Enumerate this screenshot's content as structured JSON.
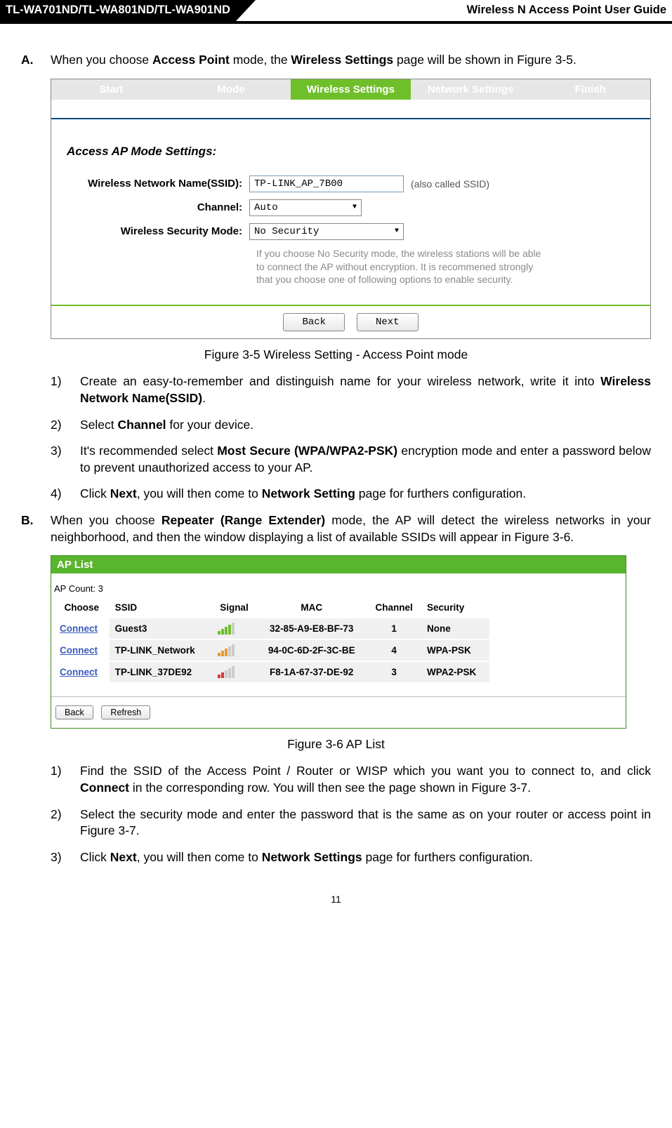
{
  "header": {
    "models": "TL-WA701ND/TL-WA801ND/TL-WA901ND",
    "title": "Wireless N Access Point User Guide"
  },
  "sectionA": {
    "marker": "A.",
    "text_pre": "When you choose ",
    "bold1": "Access Point",
    "text_mid": " mode, the ",
    "bold2": "Wireless Settings",
    "text_post": " page will be shown in Figure 3-5."
  },
  "fig1": {
    "steps": {
      "start": "Start",
      "mode": "Mode",
      "wireless": "Wireless Settings",
      "network": "Network Settings",
      "finish": "Finish"
    },
    "section_title": "Access AP Mode Settings:",
    "ssid_label": "Wireless Network Name(SSID):",
    "ssid_value": "TP-LINK_AP_7B00",
    "also_called": "(also called SSID)",
    "channel_label": "Channel:",
    "channel_value": "Auto",
    "security_label": "Wireless Security Mode:",
    "security_value": "No Security",
    "note": "If you choose No Security mode, the wireless stations will be able to connect the AP without encryption. It is recommened strongly that you choose one of following options to enable security.",
    "back": "Back",
    "next": "Next",
    "caption": "Figure 3-5 Wireless Setting - Access Point mode"
  },
  "listA": {
    "i1": {
      "m": "1)",
      "pre": "Create an easy-to-remember and distinguish name for your wireless network, write it into ",
      "b": "Wireless Network Name(SSID)",
      "post": "."
    },
    "i2": {
      "m": "2)",
      "pre": "Select ",
      "b": "Channel",
      "post": " for your device."
    },
    "i3": {
      "m": "3)",
      "pre": "It's recommended select ",
      "b": "Most Secure (WPA/WPA2-PSK)",
      "post": " encryption mode and enter a password below to prevent unauthorized access to your AP."
    },
    "i4": {
      "m": "4)",
      "pre": "Click ",
      "b1": "Next",
      "mid": ", you will then come to ",
      "b2": "Network Setting",
      "post": " page for furthers configuration."
    }
  },
  "sectionB": {
    "marker": "B.",
    "pre": "When you choose ",
    "b": "Repeater (Range Extender)",
    "post": " mode, the AP will detect the wireless networks in your neighborhood, and then the window displaying a list of available SSIDs will appear in Figure 3-6."
  },
  "fig2": {
    "title": "AP List",
    "count": "AP Count: 3",
    "headers": {
      "choose": "Choose",
      "ssid": "SSID",
      "signal": "Signal",
      "mac": "MAC",
      "channel": "Channel",
      "security": "Security"
    },
    "rows": [
      {
        "connect": "Connect",
        "ssid": "Guest3",
        "mac": "32-85-A9-E8-BF-73",
        "channel": "1",
        "security": "None"
      },
      {
        "connect": "Connect",
        "ssid": "TP-LINK_Network",
        "mac": "94-0C-6D-2F-3C-BE",
        "channel": "4",
        "security": "WPA-PSK"
      },
      {
        "connect": "Connect",
        "ssid": "TP-LINK_37DE92",
        "mac": "F8-1A-67-37-DE-92",
        "channel": "3",
        "security": "WPA2-PSK"
      }
    ],
    "back": "Back",
    "refresh": "Refresh",
    "caption": "Figure 3-6 AP List"
  },
  "listB": {
    "i1": {
      "m": "1)",
      "pre": "Find the SSID of the Access Point / Router or WISP which you want you to connect to, and click ",
      "b": "Connect",
      "post": " in the corresponding row. You will then see the page shown in Figure 3-7."
    },
    "i2": {
      "m": "2)",
      "t": "Select the security mode and enter the password that is the same as on your router or access point in Figure 3-7."
    },
    "i3": {
      "m": "3)",
      "pre": "Click ",
      "b1": "Next",
      "mid": ", you will then come to ",
      "b2": "Network Settings",
      "post": " page for furthers configuration."
    }
  },
  "page_number": "11"
}
